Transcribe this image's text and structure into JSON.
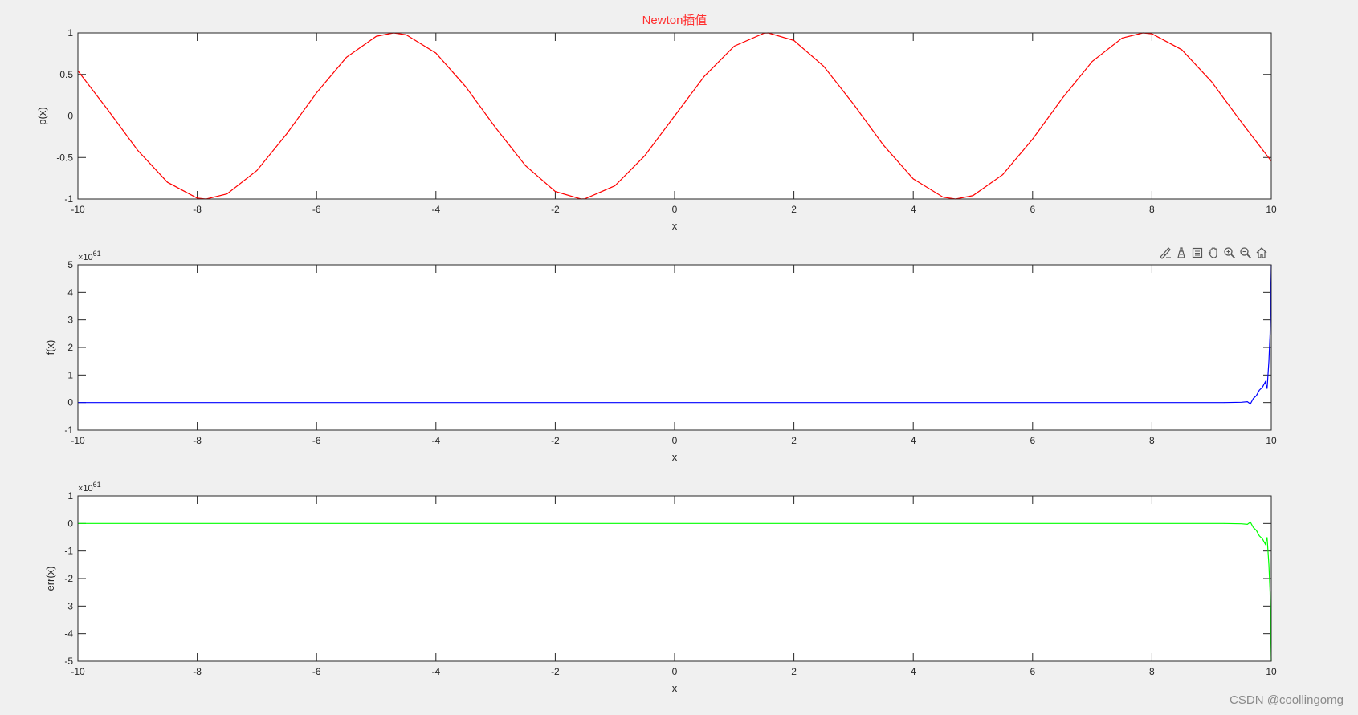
{
  "figure_title": "Newton插值",
  "watermark": "CSDN @coollingomg",
  "colors": {
    "background": "#f0f0f0",
    "axes_background": "#ffffff",
    "title": "#ff3030",
    "p_line": "#ff0000",
    "f_line": "#0000ff",
    "err_line": "#00ff00"
  },
  "toolbar": {
    "icons": [
      "brush-icon",
      "data-tips-icon",
      "legend-icon",
      "pan-hand-icon",
      "zoom-in-icon",
      "zoom-out-icon",
      "home-icon"
    ]
  },
  "chart_data": [
    {
      "type": "line",
      "title": "Newton插值",
      "xlabel": "x",
      "ylabel": "p(x)",
      "xlim": [
        -10,
        10
      ],
      "ylim": [
        -1,
        1
      ],
      "xticks": [
        "-10",
        "-8",
        "-6",
        "-4",
        "-2",
        "0",
        "2",
        "4",
        "6",
        "8",
        "10"
      ],
      "yticks": [
        "1",
        "0.5",
        "0",
        "-0.5",
        "-1"
      ],
      "series": [
        {
          "color": "#ff0000",
          "x": [
            -10,
            -9.5,
            -9,
            -8.5,
            -8,
            -7.85,
            -7.5,
            -7,
            -6.5,
            -6,
            -5.5,
            -5,
            -4.71,
            -4.5,
            -4,
            -3.5,
            -3,
            -2.5,
            -2,
            -1.57,
            -1.5,
            -1,
            -0.5,
            0,
            0.5,
            1,
            1.5,
            1.57,
            2,
            2.5,
            3,
            3.5,
            4,
            4.5,
            4.71,
            5,
            5.5,
            6,
            6.5,
            7,
            7.5,
            7.85,
            8,
            8.5,
            9,
            9.5,
            10
          ],
          "y": [
            0.544,
            0.075,
            -0.412,
            -0.798,
            -0.989,
            -1,
            -0.938,
            -0.657,
            -0.215,
            0.279,
            0.706,
            0.959,
            1,
            0.978,
            0.757,
            0.351,
            -0.141,
            -0.598,
            -0.909,
            -1,
            -0.997,
            -0.841,
            -0.479,
            0,
            0.479,
            0.841,
            0.997,
            1,
            0.909,
            0.598,
            0.141,
            -0.351,
            -0.757,
            -0.978,
            -1,
            -0.959,
            -0.706,
            -0.279,
            0.215,
            0.657,
            0.938,
            1,
            0.989,
            0.798,
            0.412,
            -0.075,
            -0.544
          ]
        }
      ]
    },
    {
      "type": "line",
      "xlabel": "x",
      "ylabel": "f(x)",
      "exponent": "61",
      "xlim": [
        -10,
        10
      ],
      "ylim": [
        -1,
        5
      ],
      "xticks": [
        "-10",
        "-8",
        "-6",
        "-4",
        "-2",
        "0",
        "2",
        "4",
        "6",
        "8",
        "10"
      ],
      "yticks": [
        "5",
        "4",
        "3",
        "2",
        "1",
        "0",
        "-1"
      ],
      "series": [
        {
          "color": "#0000ff",
          "x": [
            -10,
            9.2,
            9.5,
            9.6,
            9.65,
            9.7,
            9.75,
            9.8,
            9.85,
            9.9,
            9.93,
            9.96,
            9.98,
            10
          ],
          "y": [
            0,
            0,
            0.01,
            0.03,
            -0.05,
            0.15,
            0.25,
            0.45,
            0.55,
            0.75,
            0.5,
            1.5,
            2.5,
            5
          ]
        }
      ]
    },
    {
      "type": "line",
      "xlabel": "x",
      "ylabel": "err(x)",
      "exponent": "61",
      "xlim": [
        -10,
        10
      ],
      "ylim": [
        -5,
        1
      ],
      "xticks": [
        "-10",
        "-8",
        "-6",
        "-4",
        "-2",
        "0",
        "2",
        "4",
        "6",
        "8",
        "10"
      ],
      "yticks": [
        "1",
        "0",
        "-1",
        "-2",
        "-3",
        "-4",
        "-5"
      ],
      "series": [
        {
          "color": "#00ff00",
          "x": [
            -10,
            9.2,
            9.5,
            9.6,
            9.65,
            9.7,
            9.75,
            9.8,
            9.85,
            9.9,
            9.93,
            9.96,
            9.98,
            10
          ],
          "y": [
            0,
            0,
            -0.01,
            -0.03,
            0.05,
            -0.15,
            -0.25,
            -0.45,
            -0.55,
            -0.75,
            -0.5,
            -1.5,
            -2.5,
            -5
          ]
        }
      ]
    }
  ]
}
